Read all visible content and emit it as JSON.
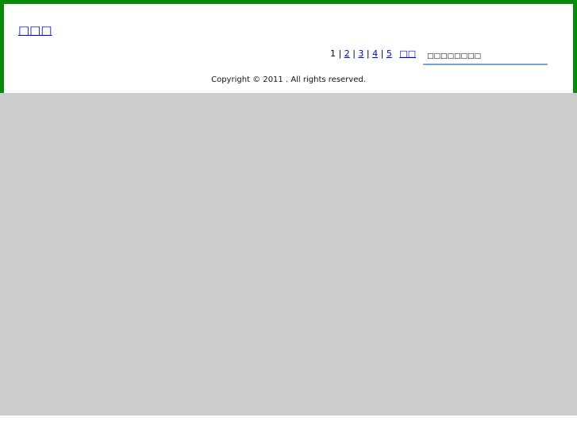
{
  "header": {
    "site_title": "□□□"
  },
  "pagination": {
    "current": "1",
    "separator": "|",
    "pages": [
      "2",
      "3",
      "4",
      "5"
    ],
    "next_label": "□□"
  },
  "search": {
    "placeholder": "□□□□□□□□"
  },
  "footer": {
    "copyright": "Copyright © 2011 . All rights reserved."
  },
  "colors": {
    "frame_border": "#0a8a0a",
    "link": "#0000cc",
    "search_underline": "#7aa3e0",
    "content_background": "#cccccc"
  }
}
